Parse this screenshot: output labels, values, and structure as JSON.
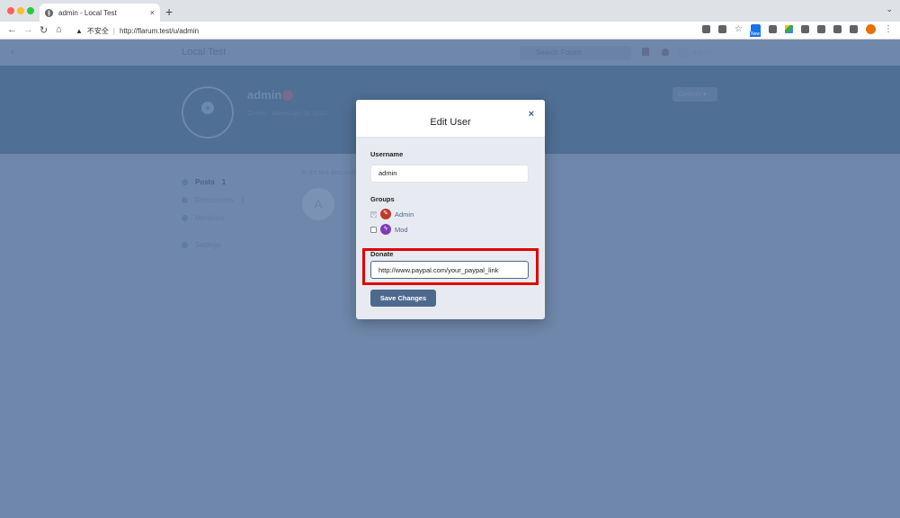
{
  "browser": {
    "tab_title": "admin - Local Test",
    "tab_close": "×",
    "new_tab": "+",
    "tab_menu": "⌄",
    "security_label": "不安全",
    "url": "http://flarum.test/u/admin",
    "new_badge": "New"
  },
  "forum": {
    "title": "Local Test",
    "search_placeholder": "Search Forum",
    "user_name": "admin",
    "profile_name": "admin",
    "profile_meta": "Online · Joined Apr 18, 2022",
    "controls_label": "Controls ▾",
    "nav": [
      {
        "label": "Posts",
        "count": "1"
      },
      {
        "label": "Discussions",
        "count": "1"
      },
      {
        "label": "Mentions",
        "count": ""
      },
      {
        "label": "Settings",
        "count": ""
      }
    ],
    "post_preview": "In It's test discussion",
    "post_avatar_letter": "A"
  },
  "modal": {
    "title": "Edit User",
    "close": "×",
    "username_label": "Username",
    "username_value": "admin",
    "groups_label": "Groups",
    "groups": [
      {
        "name": "Admin",
        "checked": true,
        "disabled": true,
        "icon": "wrench-icon",
        "color": "#c1392b"
      },
      {
        "name": "Mod",
        "checked": false,
        "disabled": false,
        "icon": "bolt-icon",
        "color": "#7e3cb8"
      }
    ],
    "donate_label": "Donate",
    "donate_value": "http://www.paypal.com/your_paypal_link",
    "save_label": "Save Changes"
  },
  "colors": {
    "highlight": "#e00000",
    "primary": "#4d698e"
  }
}
